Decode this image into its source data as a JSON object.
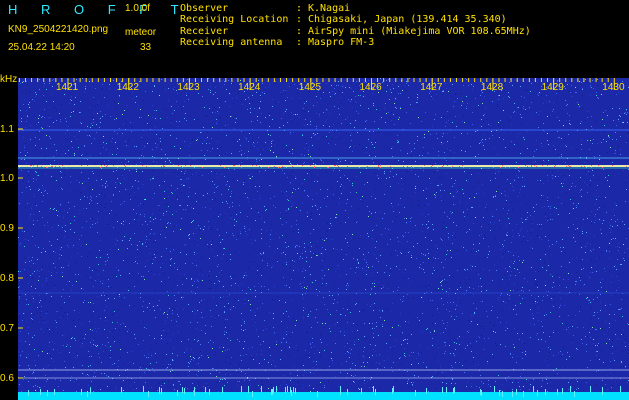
{
  "header": {
    "title": "H R O F F T",
    "version": "1.0.0f",
    "filename": "KN9_2504221420.png",
    "plot_type": "meteor",
    "datetime": "25.04.22 14:20",
    "count": "33"
  },
  "station": [
    {
      "label": "Observer",
      "value": "K.Nagai"
    },
    {
      "label": "Receiving Location",
      "value": "Chigasaki, Japan (139.414 35.340)"
    },
    {
      "label": "Receiver",
      "value": "AirSpy mini (Miakejima VOR 108.65MHz)"
    },
    {
      "label": "Receiving antenna",
      "value": "Maspro FM-3"
    }
  ],
  "axis": {
    "y_unit": "kHz",
    "y_ticks": [
      "1.1",
      "1.0",
      "0.9",
      "0.8",
      "0.7",
      "0.6"
    ],
    "x_ticks": [
      "1421",
      "1422",
      "1423",
      "1424",
      "1425",
      "1426",
      "1427",
      "1428",
      "1429",
      "1430"
    ]
  },
  "colors": {
    "background": "#1b28a8",
    "text": "#ffe000",
    "title": "#2ee8ff",
    "signal": "#ffffaa",
    "noise_floor": "#00e0ff"
  }
}
